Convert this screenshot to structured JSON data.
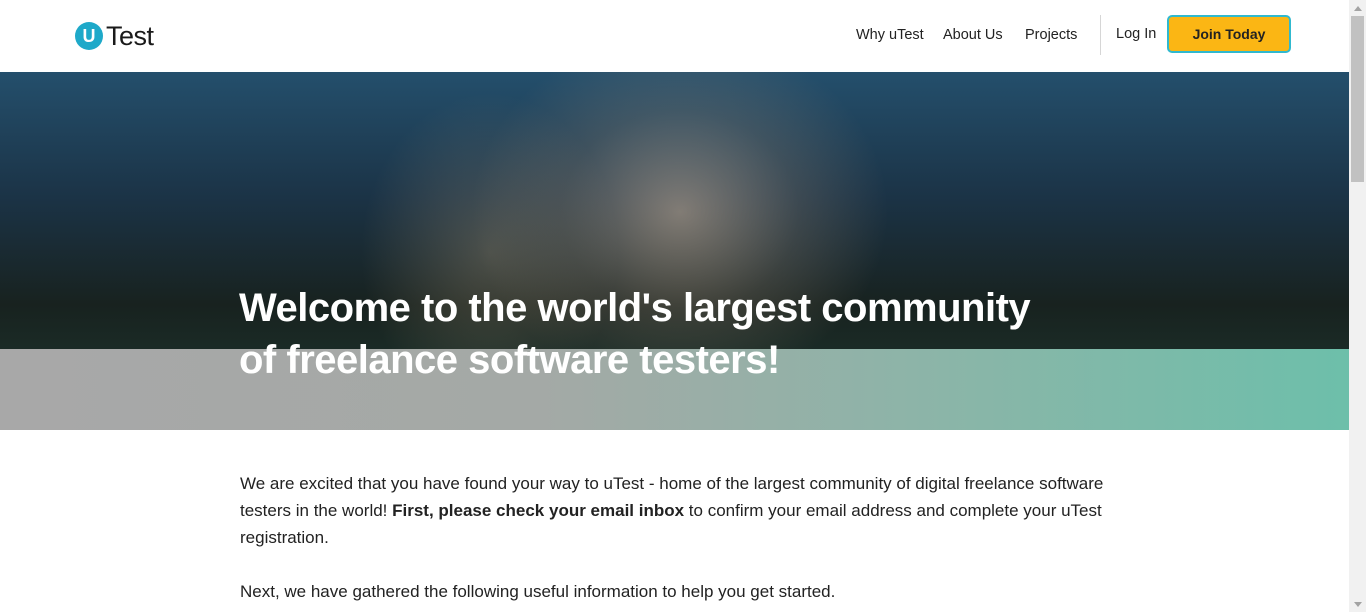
{
  "header": {
    "logo_badge": "U",
    "logo_text": "Test",
    "nav": [
      {
        "label": "Why uTest"
      },
      {
        "label": "About Us"
      },
      {
        "label": "Projects"
      }
    ],
    "login_label": "Log In",
    "join_label": "Join Today"
  },
  "hero": {
    "title_line1": "Welcome to the world's largest community",
    "title_line2": "of freelance software testers!"
  },
  "content": {
    "para1_start": "We are excited that you have found your way to uTest - home of the largest community of digital freelance software testers in the world! ",
    "para1_bold": "First, please check your email inbox",
    "para1_end": " to confirm your email address and complete your uTest registration.",
    "para2": "Next, we have gathered the following useful information to help you get started."
  },
  "colors": {
    "brand_blue": "#1ea9c9",
    "join_button": "#fbb614",
    "join_border": "#30b9cf"
  }
}
